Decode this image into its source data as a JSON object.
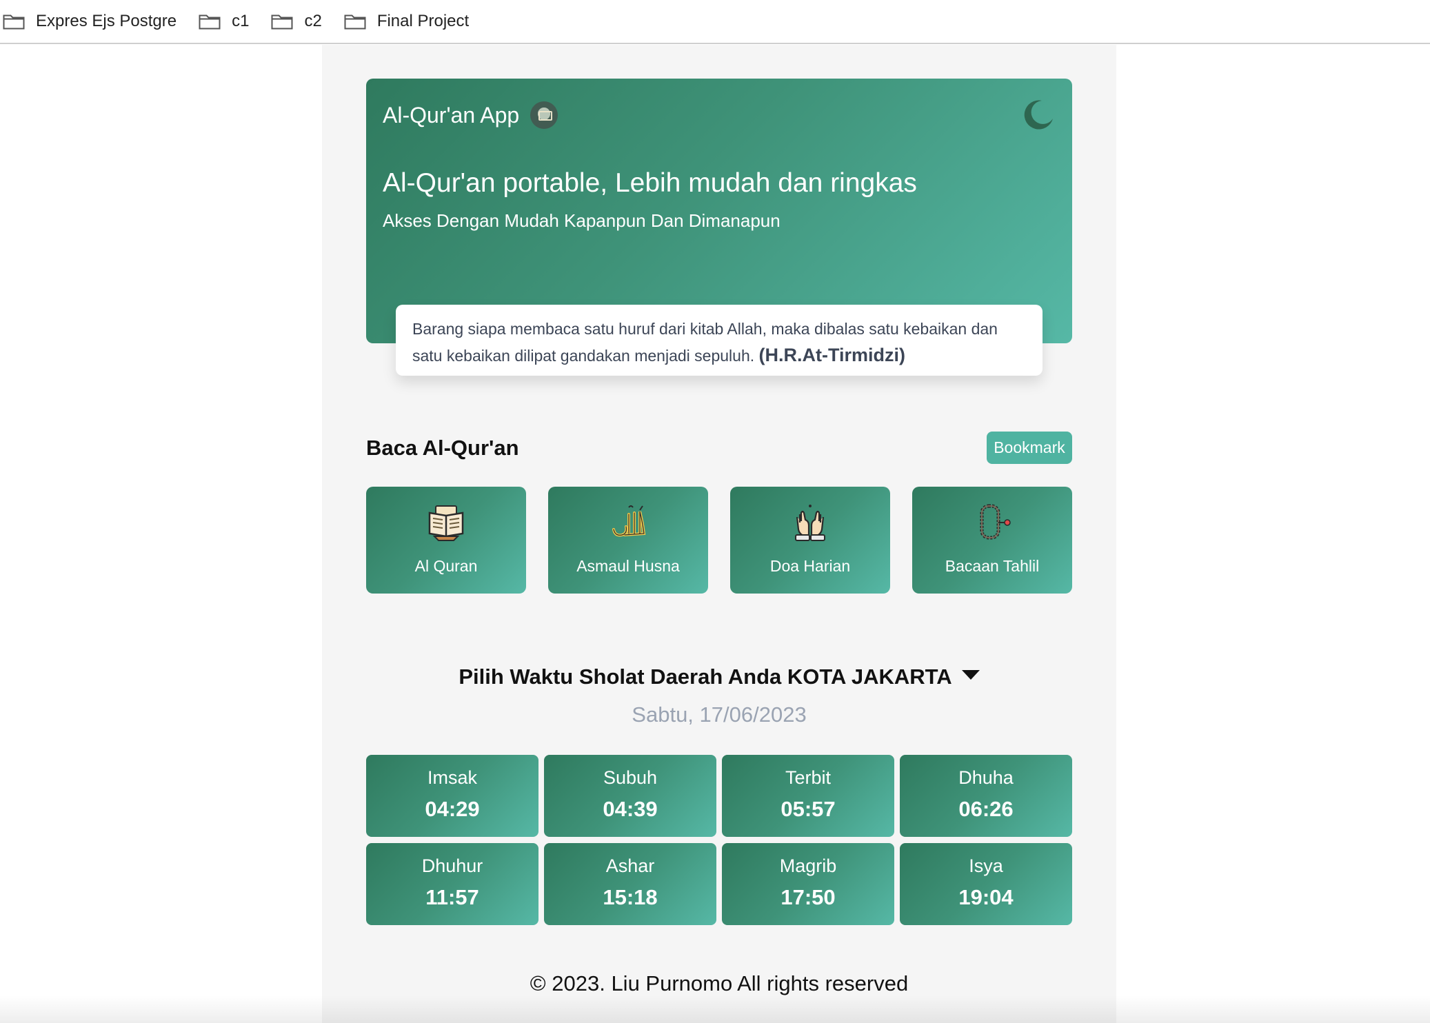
{
  "bookmarks": [
    {
      "label": "Expres Ejs Postgre",
      "icon": "folder-icon"
    },
    {
      "label": "c1",
      "icon": "folder-icon"
    },
    {
      "label": "c2",
      "icon": "folder-icon"
    },
    {
      "label": "Final Project",
      "icon": "folder-icon"
    }
  ],
  "hero": {
    "brand": "Al-Qur'an App",
    "title": "Al-Qur'an portable, Lebih mudah dan ringkas",
    "subtitle": "Akses Dengan Mudah Kapanpun Dan Dimanapun",
    "theme_toggle_icon": "moon-icon",
    "quote": "Barang siapa membaca satu huruf dari kitab Allah, maka dibalas satu kebaikan dan satu kebaikan dilipat gandakan menjadi sepuluh.",
    "quote_source": "(H.R.At-Tirmidzi)"
  },
  "read_section": {
    "title": "Baca Al-Qur'an",
    "bookmark_label": "Bookmark",
    "menu": [
      {
        "label": "Al Quran",
        "icon": "open-book-icon"
      },
      {
        "label": "Asmaul Husna",
        "icon": "allah-calligraphy-icon"
      },
      {
        "label": "Doa Harian",
        "icon": "praying-hands-icon"
      },
      {
        "label": "Bacaan Tahlil",
        "icon": "prayer-beads-icon"
      }
    ]
  },
  "prayer": {
    "heading": "Pilih Waktu Sholat Daerah Anda",
    "city": "KOTA JAKARTA",
    "date": "Sabtu, 17/06/2023",
    "times": [
      {
        "name": "Imsak",
        "time": "04:29"
      },
      {
        "name": "Subuh",
        "time": "04:39"
      },
      {
        "name": "Terbit",
        "time": "05:57"
      },
      {
        "name": "Dhuha",
        "time": "06:26"
      },
      {
        "name": "Dhuhur",
        "time": "11:57"
      },
      {
        "name": "Ashar",
        "time": "15:18"
      },
      {
        "name": "Magrib",
        "time": "17:50"
      },
      {
        "name": "Isya",
        "time": "19:04"
      }
    ]
  },
  "footer": "© 2023. Liu Purnomo All rights reserved",
  "colors": {
    "gradient_start": "#2f7a5e",
    "gradient_end": "#56b8a6",
    "accent": "#4fb3a1",
    "page_bg": "#f5f5f5"
  }
}
